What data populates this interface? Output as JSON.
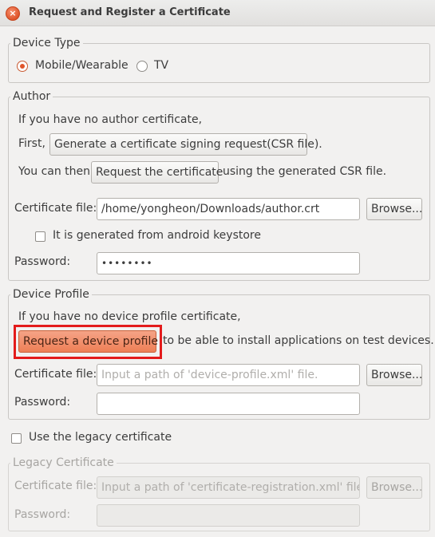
{
  "window": {
    "title": "Request and Register a Certificate",
    "close_glyph": "×"
  },
  "device_type": {
    "legend": "Device Type",
    "options": [
      {
        "label": "Mobile/Wearable",
        "selected": true
      },
      {
        "label": "TV",
        "selected": false
      }
    ]
  },
  "author": {
    "legend": "Author",
    "intro": "If you have no author certificate,",
    "first_label": "First,",
    "generate_csr_button": "Generate a certificate signing request(CSR file).",
    "then_label": "You can then",
    "request_button": "Request the certificate",
    "using_text": "using the generated CSR file.",
    "cert_file_label": "Certificate file:",
    "cert_file_value": "/home/yongheon/Downloads/author.crt",
    "browse_button": "Browse...",
    "android_checkbox_label": "It is generated from android keystore",
    "password_label": "Password:",
    "password_value": "••••••••"
  },
  "device_profile": {
    "legend": "Device Profile",
    "intro": "If you have no device profile certificate,",
    "request_button": "Request a device profile",
    "suffix_text": "to be able to install applications on test devices.",
    "cert_file_label": "Certificate file:",
    "cert_file_placeholder": "Input a path of 'device-profile.xml' file.",
    "browse_button": "Browse...",
    "password_label": "Password:"
  },
  "legacy_checkbox_label": "Use the legacy certificate",
  "legacy": {
    "legend": "Legacy Certificate",
    "cert_file_label": "Certificate file:",
    "cert_file_placeholder": "Input a path of 'certificate-registration.xml' file.",
    "browse_button": "Browse...",
    "password_label": "Password:"
  },
  "colors": {
    "accent": "#ee7f56",
    "highlight": "#e31b1b",
    "background": "#f2f1f0"
  }
}
